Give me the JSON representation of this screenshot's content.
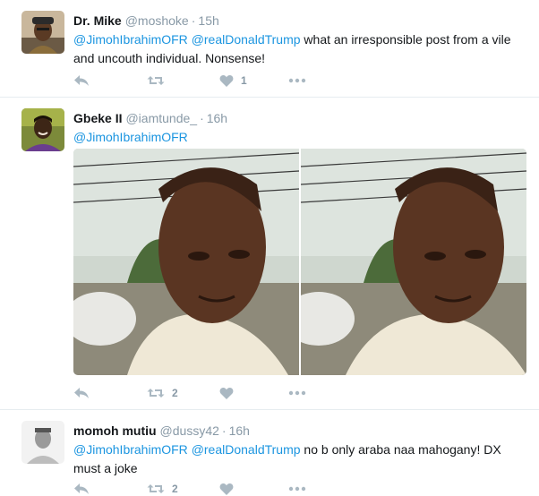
{
  "tweets": [
    {
      "name": "Dr. Mike",
      "handle": "@moshoke",
      "separator": "·",
      "time": "15h",
      "mention_1": "@JimohIbrahimOFR",
      "mention_2": "@realDonaldTrump",
      "text": " what an irresponsible post from a vile and uncouth individual. Nonsense!",
      "retweets": "",
      "likes": "1"
    },
    {
      "name": "Gbeke II",
      "handle": "@iamtunde_",
      "separator": "·",
      "time": "16h",
      "mention_1": "@JimohIbrahimOFR",
      "retweets": "2",
      "likes": ""
    },
    {
      "name": "momoh mutiu",
      "handle": "@dussy42",
      "separator": "·",
      "time": "16h",
      "mention_1": "@JimohIbrahimOFR",
      "mention_2": "@realDonaldTrump",
      "text": " no b only araba naa mahogany! DX must a joke",
      "retweets": "2",
      "likes": ""
    }
  ],
  "icons": {
    "reply": "reply-icon",
    "retweet": "retweet-icon",
    "like": "heart-icon",
    "more": "more-icon"
  },
  "colors": {
    "link": "#1b95e0",
    "action": "#aab8c2",
    "meta": "#8899a6"
  }
}
